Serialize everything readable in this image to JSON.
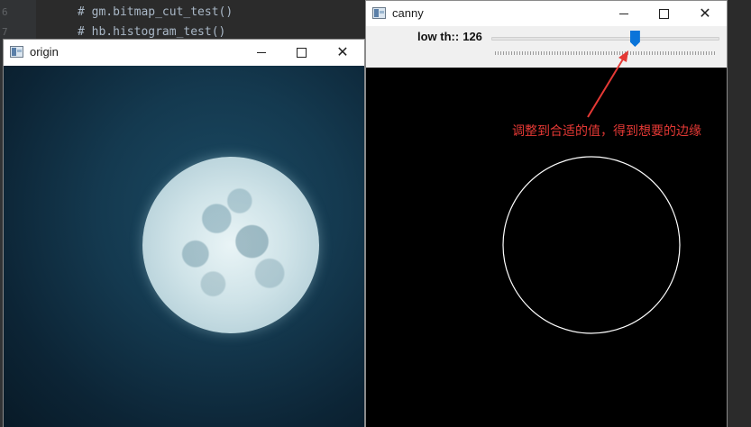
{
  "editor": {
    "lines": [
      {
        "number": "6",
        "text": "# gm.bitmap_cut_test()"
      },
      {
        "number": "7",
        "text": "# hb.histogram_test()"
      }
    ]
  },
  "origin_window": {
    "title": "origin",
    "minimize": "",
    "maximize": "",
    "close": "✕"
  },
  "canny_window": {
    "title": "canny",
    "minimize": "",
    "maximize": "",
    "close": "✕",
    "trackbar": {
      "label": "low th::",
      "value": "126",
      "fraction": 0.63
    }
  },
  "annotation": {
    "text": "调整到合适的值，得到想要的边缘",
    "color": "#e53935"
  },
  "colors": {
    "editor_bg": "#2b2b2b",
    "code_comment": "#a9b7c6",
    "slider_thumb": "#0a74d9"
  }
}
